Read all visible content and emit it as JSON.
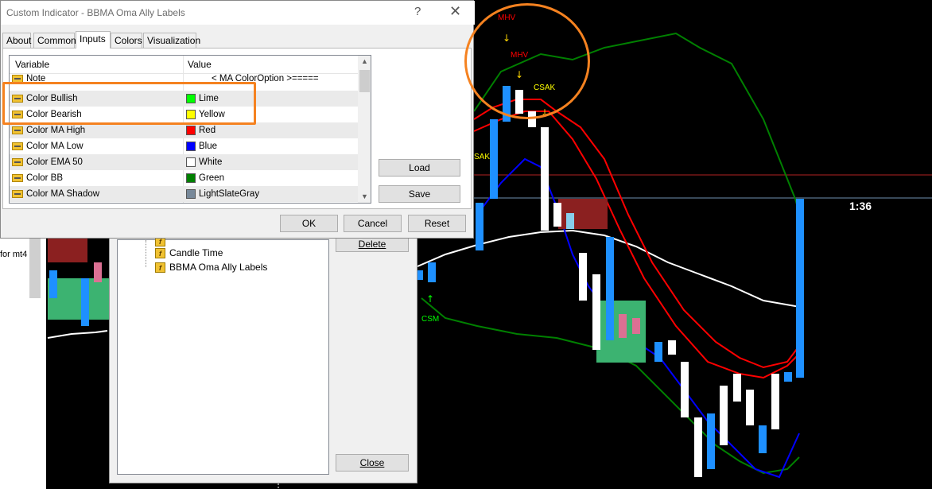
{
  "dialog": {
    "title": "Custom Indicator - BBMA Oma Ally Labels",
    "help": "?",
    "close": "✕",
    "tabs": [
      "About",
      "Common",
      "Inputs",
      "Colors",
      "Visualization"
    ],
    "active_tab": "Inputs",
    "grid": {
      "headers": {
        "variable": "Variable",
        "value": "Value"
      },
      "rows": [
        {
          "variable": "Note",
          "value": "< MA ColorOption >=====",
          "color": ""
        },
        {
          "variable": "Color Bullish",
          "value": "Lime",
          "color": "#00ff00"
        },
        {
          "variable": "Color Bearish",
          "value": "Yellow",
          "color": "#ffff00"
        },
        {
          "variable": "Color MA High",
          "value": "Red",
          "color": "#ff0000"
        },
        {
          "variable": "Color MA Low",
          "value": "Blue",
          "color": "#0000ff"
        },
        {
          "variable": "Color EMA 50",
          "value": "White",
          "color": "#ffffff"
        },
        {
          "variable": "Color BB",
          "value": "Green",
          "color": "#008000"
        },
        {
          "variable": "Color MA Shadow",
          "value": "LightSlateGray",
          "color": "#778899"
        }
      ]
    },
    "buttons": {
      "load": "Load",
      "save": "Save",
      "ok": "OK",
      "cancel": "Cancel",
      "reset": "Reset"
    },
    "highlight_color": "#f58220"
  },
  "navigator": {
    "items": [
      "Candle Time",
      "BBMA Oma Ally Labels"
    ],
    "delete": "Delete",
    "close": "Close"
  },
  "background": {
    "left_text": "for mt4"
  },
  "chart": {
    "countdown": "1:36",
    "labels": {
      "mhv1": "MHV",
      "mhv2": "MHV",
      "csak1": "CSAK",
      "csak2": "SAK",
      "csm": "CSM"
    },
    "colors": {
      "bull": "#1e90ff",
      "bear": "#ffffff",
      "ma_high": "#ff0000",
      "ma_low": "#0000ff",
      "bb": "#008000",
      "ema": "#ffffff",
      "label_red": "#ff0000",
      "label_yellow": "#ffff00",
      "label_green": "#00ff00"
    }
  }
}
